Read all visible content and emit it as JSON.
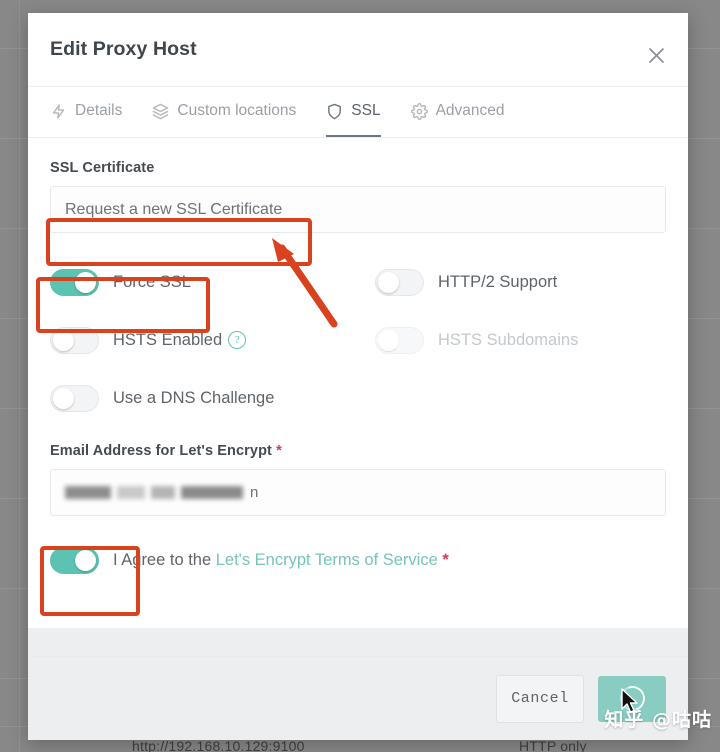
{
  "backdrop": {
    "url_text": "http://192.168.10.129:9100",
    "scheme_text": "HTTP only"
  },
  "modal": {
    "title": "Edit Proxy Host",
    "close_label": "×",
    "tabs": [
      {
        "label": "Details",
        "icon": "bolt-icon",
        "active": false
      },
      {
        "label": "Custom locations",
        "icon": "layers-icon",
        "active": false
      },
      {
        "label": "SSL",
        "icon": "shield-icon",
        "active": true
      },
      {
        "label": "Advanced",
        "icon": "gear-icon",
        "active": false
      }
    ],
    "ssl_certificate": {
      "label": "SSL Certificate",
      "selected_option": "Request a new SSL Certificate"
    },
    "toggles": [
      {
        "label": "Force SSL",
        "state": "on",
        "disabled": false,
        "help": false
      },
      {
        "label": "HTTP/2 Support",
        "state": "off",
        "disabled": false,
        "help": false
      },
      {
        "label": "HSTS Enabled",
        "state": "off",
        "disabled": false,
        "help": true,
        "help_glyph": "?"
      },
      {
        "label": "HSTS Subdomains",
        "state": "off",
        "disabled": true,
        "help": false
      },
      {
        "label": "Use a DNS Challenge",
        "state": "off",
        "disabled": false,
        "help": false
      }
    ],
    "email": {
      "label": "Email Address for Let's Encrypt",
      "required_marker": "*",
      "value_redacted": true,
      "value_tail": "n"
    },
    "agreement": {
      "toggle_state": "on",
      "prefix_text": "I Agree to the",
      "link_text": "Let's Encrypt Terms of Service",
      "required_marker": "*"
    },
    "footer": {
      "cancel_label": "Cancel",
      "save_state": "loading",
      "save_icon": "spinner-icon"
    }
  },
  "annotations": {
    "color": "#d9421f",
    "boxes": [
      "request-a-new-ssl-certificate",
      "force-ssl-toggle",
      "i-agree-toggle"
    ],
    "arrow": "points-to-ssl-certificate-select"
  },
  "watermark": {
    "text": "知乎 @咕咕"
  },
  "colors": {
    "accent_teal": "#5cc2b1",
    "save_button": "#88ccc2",
    "annotation_red": "#d9421f",
    "required_star": "#cd3b5a",
    "link_teal": "#76c4b8"
  }
}
